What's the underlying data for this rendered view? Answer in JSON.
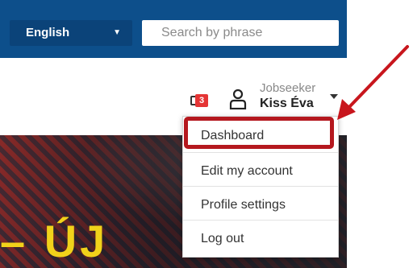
{
  "header": {
    "language": {
      "selected": "English"
    },
    "search": {
      "placeholder": "Search by phrase"
    }
  },
  "user": {
    "notifications_count": "3",
    "role": "Jobseeker",
    "name": "Kiss Éva"
  },
  "menu": {
    "items": [
      "Dashboard",
      "Edit my account",
      "Profile settings",
      "Log out"
    ]
  },
  "hero": {
    "text": "– ÚJ"
  },
  "colors": {
    "header_bg": "#0d4f8b",
    "highlight": "#b5181e",
    "badge": "#e53535",
    "hero_text": "#f1d21a"
  },
  "icons": [
    "chevron-down-icon",
    "envelope-icon",
    "user-icon",
    "dropdown-caret-icon",
    "annotation-arrow"
  ]
}
